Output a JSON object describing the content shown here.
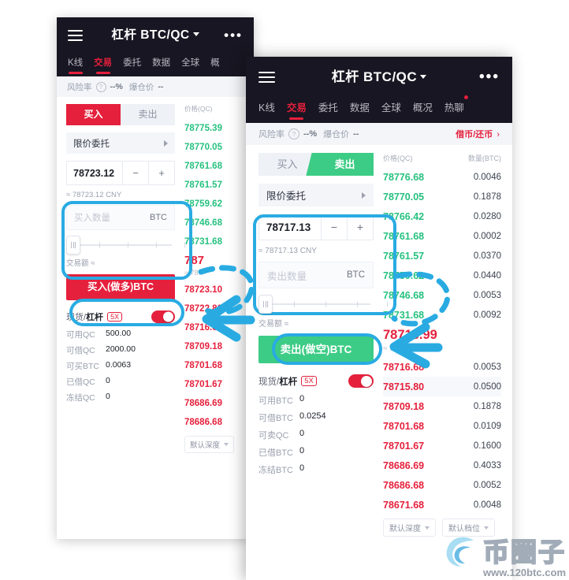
{
  "colors": {
    "red": "#e5203c",
    "green": "#3dcc85",
    "green_text": "#26c17f",
    "header_bg": "#181622",
    "highlight": "#29ABE2"
  },
  "phone1": {
    "header": {
      "menu_icon": "hamburger-icon",
      "title": "杠杆 BTC/QC",
      "more_icon": "more-icon",
      "tabs": [
        {
          "label": "K线",
          "active": false
        },
        {
          "label": "交易",
          "active": true
        },
        {
          "label": "委托",
          "active": false
        },
        {
          "label": "数据",
          "active": false
        },
        {
          "label": "全球",
          "active": false
        },
        {
          "label": "概",
          "active": false
        }
      ]
    },
    "risk": {
      "label": "风险率",
      "help_icon": "question-icon",
      "value": "--%",
      "liq_label": "爆仓价",
      "liq_value": "--"
    },
    "form": {
      "buy_tab": "买入",
      "sell_tab": "卖出",
      "order_type": "限价委托",
      "price": "78723.12",
      "minus": "−",
      "plus": "+",
      "approx_prefix": "≈",
      "approx_value": "78723.12 CNY",
      "amount_placeholder": "买入数量",
      "amount_unit": "BTC",
      "trade_amount_label": "交易额 ≈",
      "submit_label": "买入(做多)BTC"
    },
    "account": {
      "mode_spot": "现货/",
      "mode_margin": "杠杆",
      "leverage": "5X",
      "rows": [
        {
          "key": "可用QC",
          "value": "500.00"
        },
        {
          "key": "可借QC",
          "value": "2000.00"
        },
        {
          "key": "可买BTC",
          "value": "0.0063"
        },
        {
          "key": "已借QC",
          "value": "0"
        },
        {
          "key": "冻结QC",
          "value": "0"
        }
      ]
    },
    "orderbook": {
      "price_header": "价格(QC)",
      "asks": [
        "78775.39",
        "78770.05",
        "78761.68",
        "78761.57",
        "78759.62",
        "78746.68",
        "78731.68"
      ],
      "last_price": "787",
      "last_cny": "≈ 787",
      "bids": [
        "78723.10",
        "78722.80",
        "78716.68",
        "78709.18",
        "78701.68",
        "78701.67",
        "78686.69",
        "78686.68"
      ],
      "depth_label": "默认深度"
    }
  },
  "phone2": {
    "header": {
      "menu_icon": "hamburger-icon",
      "title": "杠杆 BTC/QC",
      "more_icon": "more-icon",
      "tabs": [
        {
          "label": "K线",
          "active": false,
          "dot": false
        },
        {
          "label": "交易",
          "active": true,
          "dot": false
        },
        {
          "label": "委托",
          "active": false,
          "dot": false
        },
        {
          "label": "数据",
          "active": false,
          "dot": false
        },
        {
          "label": "全球",
          "active": false,
          "dot": false
        },
        {
          "label": "概况",
          "active": false,
          "dot": false
        },
        {
          "label": "热聊",
          "active": false,
          "dot": true
        }
      ]
    },
    "risk": {
      "label": "风险率",
      "help_icon": "question-icon",
      "value": "--%",
      "liq_label": "爆仓价",
      "liq_value": "--",
      "borrow_link": "借币/还币"
    },
    "form": {
      "buy_tab": "买入",
      "sell_tab": "卖出",
      "order_type": "限价委托",
      "price": "78717.13",
      "minus": "−",
      "plus": "+",
      "approx_prefix": "≈",
      "approx_value": "78717.13 CNY",
      "amount_placeholder": "卖出数量",
      "amount_unit": "BTC",
      "trade_amount_label": "交易额 ≈",
      "submit_label": "卖出(做空)BTC"
    },
    "account": {
      "mode_spot": "现货/",
      "mode_margin": "杠杆",
      "leverage": "5X",
      "rows": [
        {
          "key": "可用BTC",
          "value": "0"
        },
        {
          "key": "可借BTC",
          "value": "0.0254"
        },
        {
          "key": "可卖QC",
          "value": "0"
        },
        {
          "key": "已借BTC",
          "value": "0"
        },
        {
          "key": "冻结BTC",
          "value": "0"
        }
      ]
    },
    "orderbook": {
      "price_header": "价格(QC)",
      "qty_header": "数量(BTC)",
      "asks": [
        {
          "price": "78776.68",
          "qty": "0.0046"
        },
        {
          "price": "78770.05",
          "qty": "0.1878"
        },
        {
          "price": "78766.42",
          "qty": "0.0280"
        },
        {
          "price": "78761.68",
          "qty": "0.0002"
        },
        {
          "price": "78761.57",
          "qty": "0.0370"
        },
        {
          "price": "78759.62",
          "qty": "0.0440"
        },
        {
          "price": "78746.68",
          "qty": "0.0053"
        },
        {
          "price": "78731.68",
          "qty": "0.0092"
        }
      ],
      "last_price": "78716.99",
      "last_cny": "≈ 78716.99 CNY",
      "bids": [
        {
          "price": "78716.68",
          "qty": "0.0053",
          "hl": false
        },
        {
          "price": "78715.80",
          "qty": "0.0500",
          "hl": true
        },
        {
          "price": "78709.18",
          "qty": "0.1878",
          "hl": false
        },
        {
          "price": "78701.68",
          "qty": "0.0109",
          "hl": false
        },
        {
          "price": "78701.67",
          "qty": "0.1600",
          "hl": false
        },
        {
          "price": "78686.69",
          "qty": "0.4033",
          "hl": false
        },
        {
          "price": "78686.68",
          "qty": "0.0052",
          "hl": false
        },
        {
          "price": "78671.68",
          "qty": "0.0048",
          "hl": false
        }
      ],
      "depth_label": "默认深度",
      "grade_label": "默认档位"
    }
  },
  "watermark": {
    "text": "币圈子",
    "url": "www.120btc.com"
  }
}
